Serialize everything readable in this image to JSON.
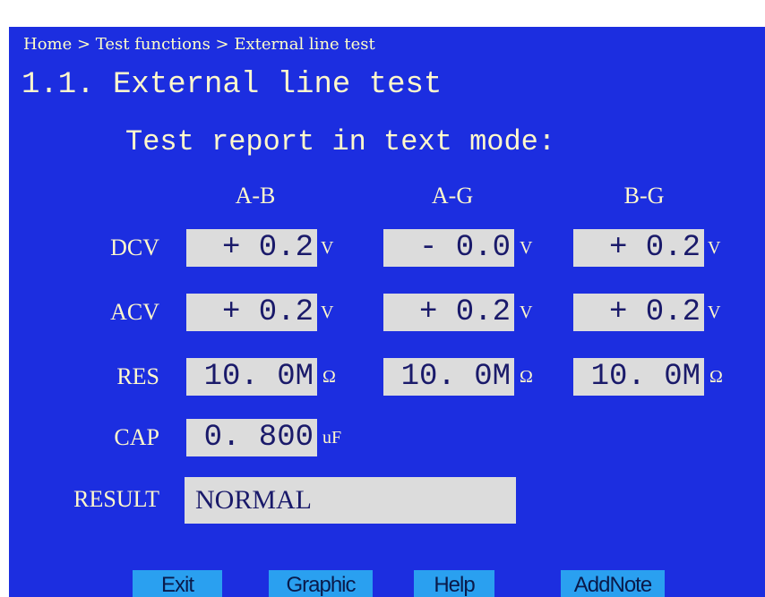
{
  "breadcrumb": "Home > Test functions > External line test",
  "title": "1.1. External line test",
  "subtitle": "Test report in text mode:",
  "columns": [
    "A-B",
    "A-G",
    "B-G"
  ],
  "rows": [
    {
      "label": "DCV",
      "values": [
        "+ 0.2",
        "- 0.0",
        "+ 0.2"
      ],
      "unit": "V"
    },
    {
      "label": "ACV",
      "values": [
        "+ 0.2",
        "+ 0.2",
        "+ 0.2"
      ],
      "unit": "V"
    },
    {
      "label": "RES",
      "values": [
        "10. 0M",
        "10. 0M",
        "10. 0M"
      ],
      "unit": "Ω"
    },
    {
      "label": "CAP",
      "values": [
        "0. 800"
      ],
      "unit": "uF"
    }
  ],
  "result": {
    "label": "RESULT",
    "value": "NORMAL"
  },
  "buttons": {
    "exit": "Exit",
    "graphic": "Graphic",
    "help": "Help",
    "addnote": "AddNote"
  },
  "colors": {
    "background": "#1c2ee0",
    "field": "#dcdcdc",
    "text": "#fff8cc",
    "button": "#2aa0f0"
  }
}
